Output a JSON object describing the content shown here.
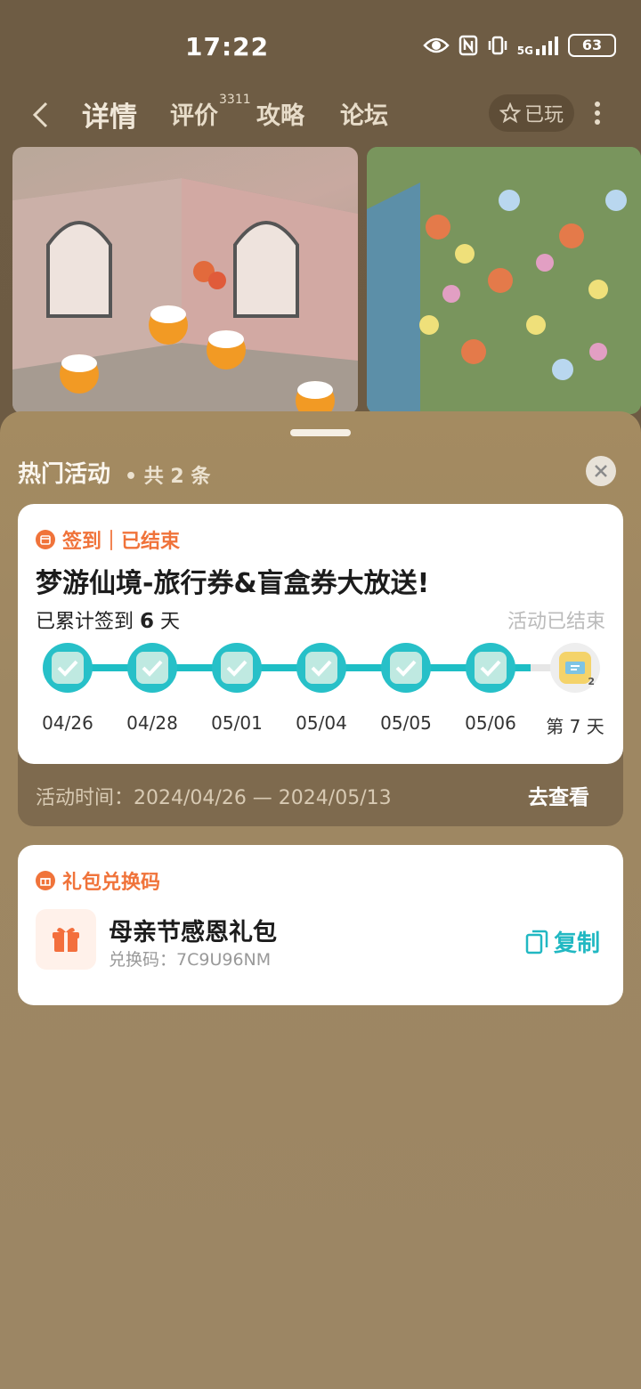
{
  "status_bar": {
    "time": "17:22",
    "network": "5G",
    "battery": "63"
  },
  "nav": {
    "tabs": [
      {
        "label": "详情",
        "active": true
      },
      {
        "label": "评价",
        "badge": "3311"
      },
      {
        "label": "攻略"
      },
      {
        "label": "论坛"
      }
    ],
    "played_label": "已玩"
  },
  "sheet": {
    "title": "热门活动",
    "count": "• 共 2 条",
    "activity": {
      "tag": "签到｜已结束",
      "title": "梦游仙境-旅行券&盲盒券大放送!",
      "progress_prefix": "已累计签到",
      "progress_days": "6",
      "progress_suffix": "天",
      "status": "活动已结束",
      "days": [
        {
          "label": "04/26",
          "checked": true
        },
        {
          "label": "04/28",
          "checked": true
        },
        {
          "label": "05/01",
          "checked": true
        },
        {
          "label": "05/04",
          "checked": true
        },
        {
          "label": "05/05",
          "checked": true
        },
        {
          "label": "05/06",
          "checked": true
        },
        {
          "label": "第 7 天",
          "checked": false,
          "reward_count": "2"
        }
      ],
      "time_label": "活动时间：",
      "time_range": "2024/04/26 — 2024/05/13",
      "action": "去查看"
    },
    "gift": {
      "tag": "礼包兑换码",
      "name": "母亲节感恩礼包",
      "code_label": "兑换码：",
      "code": "7C9U96NM",
      "copy_label": "复制"
    }
  },
  "colors": {
    "accent_orange": "#f0733a",
    "accent_teal": "#21b8c2"
  }
}
